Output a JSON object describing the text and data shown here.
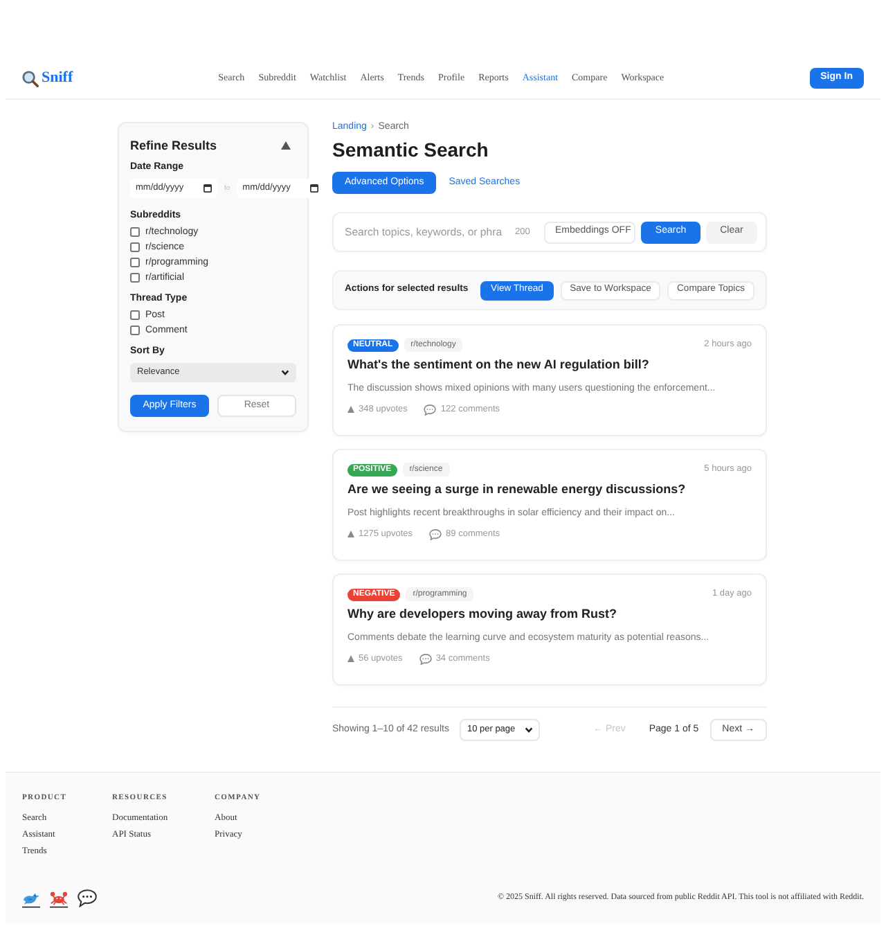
{
  "header": {
    "brand": "Sniff",
    "nav": [
      {
        "label": "Search",
        "selected": false
      },
      {
        "label": "Subreddit",
        "selected": false
      },
      {
        "label": "Watchlist",
        "selected": false
      },
      {
        "label": "Alerts",
        "selected": false
      },
      {
        "label": "Trends",
        "selected": false
      },
      {
        "label": "Profile",
        "selected": false
      },
      {
        "label": "Reports",
        "selected": false
      },
      {
        "label": "Assistant",
        "selected": true
      },
      {
        "label": "Compare",
        "selected": false
      },
      {
        "label": "Workspace",
        "selected": false
      }
    ],
    "sign_in": "Sign In"
  },
  "filters": {
    "title": "Refine Results",
    "date_range": {
      "label": "Date Range",
      "from": {
        "placeholder": "mm/dd/yyyy"
      },
      "separator": "to",
      "to": {
        "placeholder": "mm/dd/yyyy"
      }
    },
    "subreddits": {
      "label": "Subreddits",
      "options": [
        {
          "label": "r/technology",
          "checked": false
        },
        {
          "label": "r/science",
          "checked": false
        },
        {
          "label": "r/programming",
          "checked": false
        },
        {
          "label": "r/artificial",
          "checked": false
        }
      ]
    },
    "thread_type": {
      "label": "Thread Type",
      "options": [
        {
          "label": "Post",
          "checked": false
        },
        {
          "label": "Comment",
          "checked": false
        }
      ]
    },
    "sort_by": {
      "label": "Sort By",
      "value": "Relevance"
    },
    "buttons": [
      {
        "label": "Apply Filters",
        "kind": "primary"
      },
      {
        "label": "Reset",
        "kind": "secondary"
      }
    ]
  },
  "breadcrumb": {
    "items": [
      {
        "label": "Landing",
        "current": false
      },
      {
        "label": "Search",
        "current": true
      }
    ],
    "separator": "›"
  },
  "title": "Semantic Search",
  "mode_buttons": [
    {
      "label": "Advanced Options",
      "kind": "primary"
    },
    {
      "label": "Saved Searches",
      "kind": "link"
    }
  ],
  "search": {
    "placeholder": "Search topics, keywords, or phra",
    "counter": "200",
    "buttons": [
      {
        "label": "Embeddings OFF",
        "kind": "outline"
      },
      {
        "label": "Search",
        "kind": "primary"
      },
      {
        "label": "Clear",
        "kind": "muted"
      }
    ]
  },
  "actions": {
    "label": "Actions for selected results",
    "buttons": [
      {
        "label": "View Thread",
        "kind": "primary"
      },
      {
        "label": "Save to Workspace",
        "kind": "outline"
      },
      {
        "label": "Compare Topics",
        "kind": "outline"
      }
    ]
  },
  "results": [
    {
      "sentiment": "NEUTRAL",
      "color": "#1a73e8",
      "subreddit": "r/technology",
      "time": "2 hours ago",
      "title": "What's the sentiment on the new AI regulation bill?",
      "snippet": "The discussion shows mixed opinions with many users questioning the enforcement...",
      "upvotes": "348 upvotes",
      "comments": "122 comments"
    },
    {
      "sentiment": "POSITIVE",
      "color": "#34a853",
      "subreddit": "r/science",
      "time": "5 hours ago",
      "title": "Are we seeing a surge in renewable energy discussions?",
      "snippet": "Post highlights recent breakthroughs in solar efficiency and their impact on...",
      "upvotes": "1275 upvotes",
      "comments": "89 comments"
    },
    {
      "sentiment": "NEGATIVE",
      "color": "#ea4335",
      "subreddit": "r/programming",
      "time": "1 day ago",
      "title": "Why are developers moving away from Rust?",
      "snippet": "Comments debate the learning curve and ecosystem maturity as potential reasons...",
      "upvotes": "56 upvotes",
      "comments": "34 comments"
    }
  ],
  "pagination": {
    "summary": "Showing 1–10 of 42 results",
    "per_page": "10 per page",
    "prev": {
      "label": "← Prev",
      "disabled": true
    },
    "page": "Page 1 of 5",
    "next": {
      "label": "Next →",
      "disabled": false
    }
  },
  "footer": {
    "columns": [
      {
        "heading": "PRODUCT",
        "links": [
          "Search",
          "Assistant",
          "Trends"
        ]
      },
      {
        "heading": "RESOURCES",
        "links": [
          "Documentation",
          "API Status"
        ]
      },
      {
        "heading": "COMPANY",
        "links": [
          "About",
          "Privacy"
        ]
      }
    ],
    "copyright": "© 2025 Sniff. All rights reserved. Data sourced from public Reddit API. This tool is not affiliated with Reddit."
  }
}
